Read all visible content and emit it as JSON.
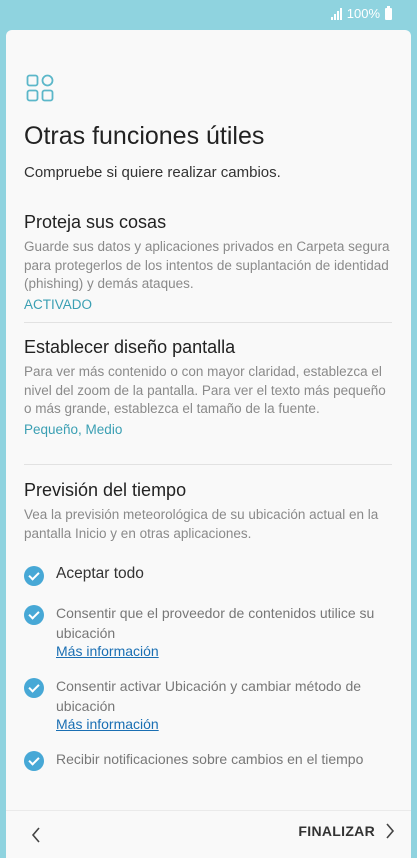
{
  "statusbar": {
    "battery_text": "100%"
  },
  "header": {
    "title": "Otras funciones útiles",
    "subtitle": "Compruebe si quiere realizar cambios."
  },
  "sections": [
    {
      "title": "Proteja sus cosas",
      "description": "Guarde sus datos y aplicaciones privados en Carpeta segura para protegerlos de los intentos de suplantación de identidad (phishing) y demás ataques.",
      "status": "ACTIVADO"
    },
    {
      "title": "Establecer diseño pantalla",
      "description": "Para ver más contenido o con mayor claridad, establezca el nivel del zoom de la pantalla. Para ver el texto más pequeño o más grande, establezca el tamaño de la fuente.",
      "status": "Pequeño, Medio"
    },
    {
      "title": "Previsión del tiempo",
      "description": "Vea la previsión meteorológica de su ubicación actual en la pantalla Inicio y en otras aplicaciones."
    }
  ],
  "checks": {
    "accept_all": "Aceptar todo",
    "items": [
      {
        "label": "Consentir que el proveedor de contenidos utilice su ubicación",
        "link": "Más información"
      },
      {
        "label": "Consentir activar Ubicación y cambiar método de ubicación",
        "link": "Más información"
      },
      {
        "label": "Recibir notificaciones sobre cambios en el tiempo"
      }
    ]
  },
  "footer": {
    "finish_label": "FINALIZAR"
  },
  "colors": {
    "accent": "#3a9fb3",
    "check": "#47a8d6",
    "link": "#1a6fb3",
    "frame": "#8fd3df"
  }
}
